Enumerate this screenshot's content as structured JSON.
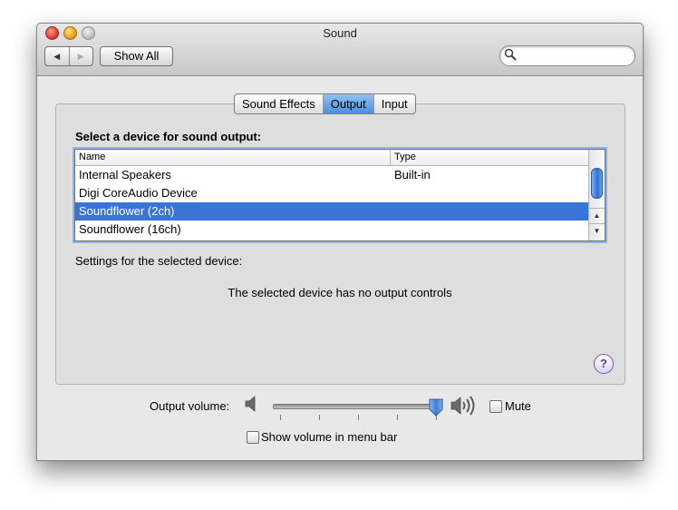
{
  "window": {
    "title": "Sound"
  },
  "toolbar": {
    "back_arrow": "◀",
    "forward_arrow": "▶",
    "show_all_label": "Show All",
    "search_value": "",
    "search_placeholder": ""
  },
  "tabs": [
    {
      "label": "Sound Effects",
      "selected": false
    },
    {
      "label": "Output",
      "selected": true
    },
    {
      "label": "Input",
      "selected": false
    }
  ],
  "output": {
    "section_label": "Select a device for sound output:",
    "columns": {
      "name": "Name",
      "type": "Type"
    },
    "devices": [
      {
        "name": "Internal Speakers",
        "type": "Built-in",
        "selected": false
      },
      {
        "name": "Digi CoreAudio Device",
        "type": "",
        "selected": false
      },
      {
        "name": "Soundflower (2ch)",
        "type": "",
        "selected": true
      },
      {
        "name": "Soundflower (16ch)",
        "type": "",
        "selected": false
      }
    ],
    "settings_label": "Settings for the selected device:",
    "no_controls_message": "The selected device has no output controls",
    "help_glyph": "?"
  },
  "footer": {
    "volume_label": "Output volume:",
    "volume_level": 0.97,
    "mute_label": "Mute",
    "mute_checked": false,
    "menubar_label": "Show volume in menu bar",
    "menubar_checked": false
  },
  "icons": {
    "close": "close-button-icon",
    "minimize": "minimize-button-icon",
    "zoom": "zoom-button-icon",
    "search": "search-icon",
    "speaker_low": "speaker-low-icon",
    "speaker_high": "speaker-high-icon"
  },
  "colors": {
    "selection": "#3875d7",
    "tab_selected": "#4a8ee0",
    "window_bg": "#e8e8e8"
  }
}
